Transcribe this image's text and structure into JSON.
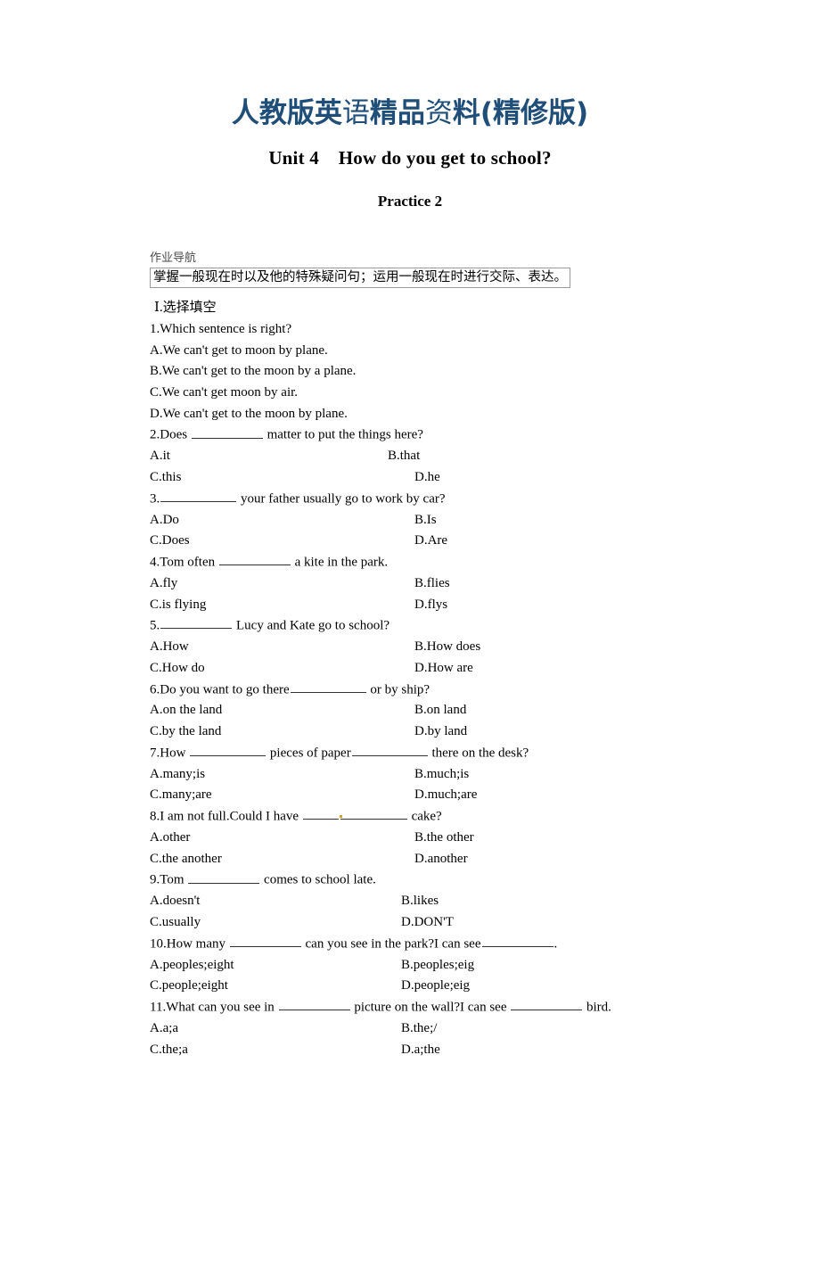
{
  "banner": {
    "segments": [
      {
        "text": "人教版英",
        "weight": "bold"
      },
      {
        "text": "语",
        "weight": "light"
      },
      {
        "text": "精品",
        "weight": "bold"
      },
      {
        "text": "资",
        "weight": "light"
      },
      {
        "text": "料(精修版)",
        "weight": "bold"
      }
    ],
    "full_text": "人教版英语精品资料(精修版)",
    "color": "#1F4E79"
  },
  "title": "Unit 4    How do you get to school?",
  "subtitle": "Practice 2",
  "nav": {
    "label": "作业导航",
    "box_text": "掌握一般现在时以及他的特殊疑问句；运用一般现在时进行交际、表达。"
  },
  "section": {
    "heading": "Ⅰ.选择填空"
  },
  "questions": [
    {
      "number": "1",
      "stem_prefix": "1.Which sentence is right?",
      "stem_suffix": "",
      "blank_after_prefix": false,
      "stacked_options": [
        "A.We can't get to moon by plane.",
        "B.We can't get to the moon by a plane.",
        "C.We can't get moon by air.",
        "D.We can't get to the moon by plane."
      ]
    },
    {
      "number": "2",
      "stem_prefix": "2.Does ",
      "stem_suffix": " matter to put the things here?",
      "blank_after_prefix": true,
      "options": {
        "A": "A.it",
        "B": "B.that",
        "C": "C.this",
        "D": "D.he"
      },
      "col_b_ab": 435,
      "col_b_cd": 465
    },
    {
      "number": "3",
      "stem_prefix": "3.",
      "stem_suffix": " your father usually go to work by car?",
      "blank_after_prefix": true,
      "options": {
        "A": "A.Do",
        "B": "B.Is",
        "C": "C.Does",
        "D": "D.Are"
      },
      "col_b_ab": 300,
      "col_b_cd": 300
    },
    {
      "number": "4",
      "stem_prefix": "4.Tom often ",
      "stem_suffix": " a kite in the park.",
      "blank_after_prefix": true,
      "options": {
        "A": "A.fly",
        "B": "B.flies",
        "C": "C.is flying",
        "D": "D.flys"
      },
      "col_b_ab": 300,
      "col_b_cd": 300
    },
    {
      "number": "5",
      "stem_prefix": "5.",
      "stem_suffix": " Lucy and Kate go to school?",
      "blank_after_prefix": true,
      "options": {
        "A": "A.How",
        "B": "B.How does",
        "C": "C.How do",
        "D": "D.How are"
      },
      "col_b_ab": 300,
      "col_b_cd": 300
    },
    {
      "number": "6",
      "stem_prefix": "6.Do you want to go there",
      "stem_suffix": " or by ship?",
      "blank_after_prefix": true,
      "options": {
        "A": "A.on the land",
        "B": "B.on land",
        "C": "C.by the land",
        "D": "D.by land"
      },
      "col_b_ab": 300,
      "col_b_cd": 300
    },
    {
      "number": "7",
      "stem_prefix": "7.How ",
      "stem_mid": " pieces of paper",
      "stem_suffix": " there on the desk?",
      "blank_after_prefix": true,
      "double_blank": true,
      "options": {
        "A": "A.many;is",
        "B": "B.much;is",
        "C": "C.many;are",
        "D": "D.much;are"
      },
      "col_b_ab": 300,
      "col_b_cd": 300
    },
    {
      "number": "8",
      "stem_prefix": "8.I am not full.Could I have ",
      "stem_suffix": " cake?",
      "blank_after_prefix": true,
      "options": {
        "A": "A.other",
        "B": "B.the other",
        "C": "C.the another",
        "D": "D.another"
      },
      "col_b_ab": 300,
      "col_b_cd": 300
    },
    {
      "number": "9",
      "stem_prefix": "9.Tom ",
      "stem_suffix": " comes to school late.",
      "blank_after_prefix": true,
      "options": {
        "A": "A.doesn't",
        "B": "B.likes",
        "C": "C.usually",
        "D": "D.DON'T"
      },
      "col_b_ab": 285,
      "col_b_cd": 285
    },
    {
      "number": "10",
      "stem_prefix": "10.How many ",
      "stem_mid": " can you see in the park?I can see",
      "stem_suffix": ".",
      "blank_after_prefix": true,
      "double_blank": true,
      "options": {
        "A": "A.peoples;eight",
        "B": "B.peoples;eig",
        "C": "C.people;eight",
        "D": "D.people;eig"
      },
      "col_b_ab": 285,
      "col_b_cd": 285
    },
    {
      "number": "11",
      "stem_prefix": "11.What can you see in ",
      "stem_mid": " picture on the wall?I can see ",
      "stem_suffix": " bird.",
      "blank_after_prefix": true,
      "double_blank": true,
      "options": {
        "A": "A.a;a",
        "B": "B.the;/",
        "C": "C.the;a",
        "D": "D.a;the"
      },
      "col_b_ab": 285,
      "col_b_cd": 285
    }
  ]
}
